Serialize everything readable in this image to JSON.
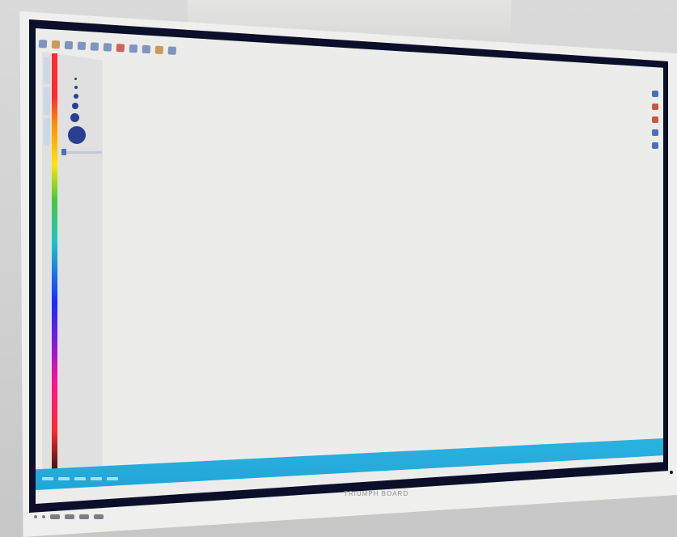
{
  "brand": {
    "name": "TRIUMPH BOARD"
  },
  "screen": {
    "left_panel_tabs": 3,
    "brush_sizes": 6
  },
  "colors": {
    "bezel": "#efefed",
    "screen_frame": "#0c0f2a",
    "canvas": "#ececea",
    "taskbar": "#2bb3df",
    "brush": "#2a3f8f"
  },
  "icons": {
    "toolbar": [
      "pen-icon",
      "shape-icon",
      "eraser-icon",
      "select-icon",
      "undo-icon",
      "redo-icon",
      "zoom-icon",
      "grid-icon",
      "color-icon",
      "text-icon",
      "save-icon"
    ],
    "right_tools": [
      "pen-icon",
      "marker-icon",
      "highlighter-icon",
      "eraser-icon",
      "pointer-icon"
    ]
  }
}
